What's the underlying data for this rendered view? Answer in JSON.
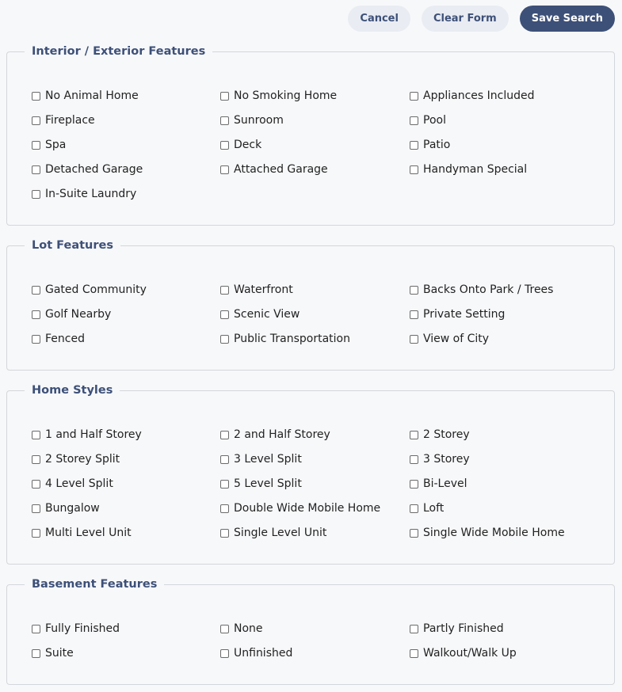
{
  "toolbar": {
    "cancel_label": "Cancel",
    "clear_label": "Clear Form",
    "save_label": "Save Search"
  },
  "sections": [
    {
      "title": "Interior / Exterior Features",
      "options": [
        "No Animal Home",
        "No Smoking Home",
        "Appliances Included",
        "Fireplace",
        "Sunroom",
        "Pool",
        "Spa",
        "Deck",
        "Patio",
        "Detached Garage",
        "Attached Garage",
        "Handyman Special",
        "In-Suite Laundry"
      ]
    },
    {
      "title": "Lot Features",
      "options": [
        "Gated Community",
        "Waterfront",
        "Backs Onto Park / Trees",
        "Golf Nearby",
        "Scenic View",
        "Private Setting",
        "Fenced",
        "Public Transportation",
        "View of City"
      ]
    },
    {
      "title": "Home Styles",
      "options": [
        "1 and Half Storey",
        "2 and Half Storey",
        "2 Storey",
        "2 Storey Split",
        "3 Level Split",
        "3 Storey",
        "4 Level Split",
        "5 Level Split",
        "Bi-Level",
        "Bungalow",
        "Double Wide Mobile Home",
        "Loft",
        "Multi Level Unit",
        "Single Level Unit",
        "Single Wide Mobile Home"
      ]
    },
    {
      "title": "Basement Features",
      "options": [
        "Fully Finished",
        "None",
        "Partly Finished",
        "Suite",
        "Unfinished",
        "Walkout/Walk Up"
      ]
    }
  ]
}
